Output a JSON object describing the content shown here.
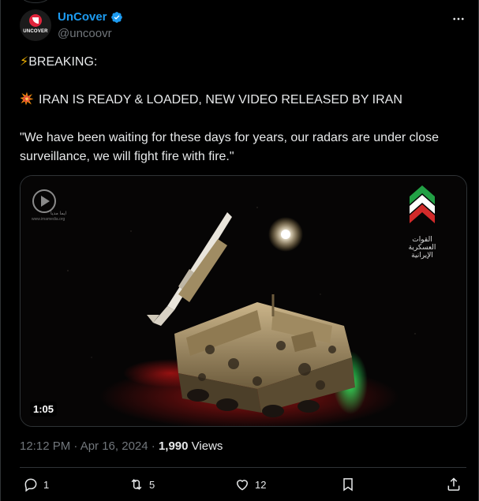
{
  "author": {
    "display_name": "UnCover",
    "handle": "@uncoovr",
    "avatar_text": "UNCOVER",
    "verified": true
  },
  "tweet": {
    "line1": "BREAKING:",
    "line2": "IRAN IS READY & LOADED, NEW VIDEO RELEASED BY IRAN",
    "line3": "\"We have been waiting for these days for years, our radars are under close surveillance, we will fight fire with fire.\""
  },
  "media": {
    "duration": "1:05",
    "watermark_left_text": "ایما مدیا",
    "watermark_left_url": "www.imamedia.org",
    "badge_text": "القوات العسكرية الإيرانية"
  },
  "meta": {
    "timestamp": "12:12 PM · Apr 16, 2024",
    "separator": " · ",
    "views_count": "1,990",
    "views_label": " Views"
  },
  "actions": {
    "replies": "1",
    "reposts": "5",
    "likes": "12"
  },
  "colors": {
    "accent": "#1d9bf0",
    "text": "#e7e9ea",
    "muted": "#71767b",
    "border": "#2f3336",
    "background": "#000000"
  }
}
